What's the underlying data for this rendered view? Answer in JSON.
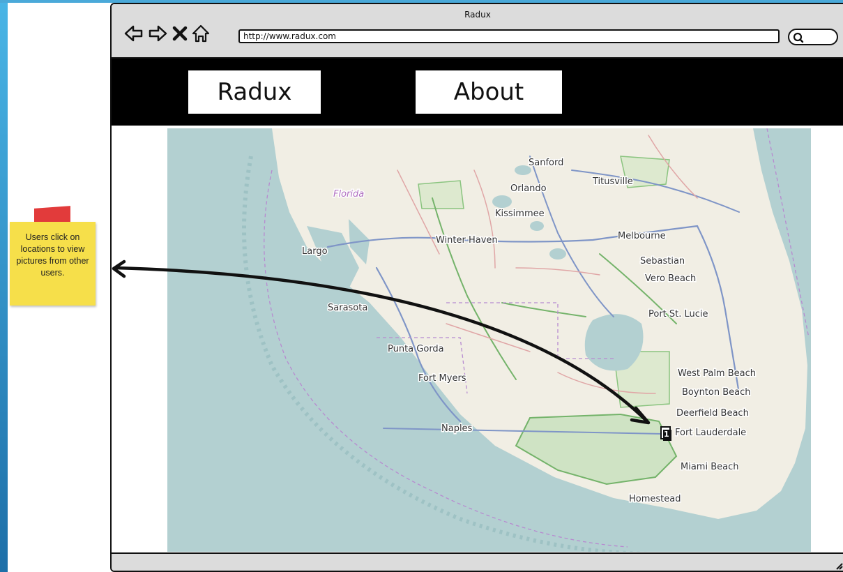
{
  "window": {
    "title": "Radux",
    "url": "http://www.radux.com"
  },
  "navbar": {
    "home_label": "Radux",
    "about_label": "About"
  },
  "note": {
    "text": "Users click on locations to view pictures from other users."
  },
  "map": {
    "labels": [
      {
        "id": "florida",
        "text": "Florida"
      },
      {
        "id": "sanford",
        "text": "Sanford"
      },
      {
        "id": "orlando",
        "text": "Orlando"
      },
      {
        "id": "titusville",
        "text": "Titusville"
      },
      {
        "id": "kissimmee",
        "text": "Kissimmee"
      },
      {
        "id": "melbourne",
        "text": "Melbourne"
      },
      {
        "id": "largo",
        "text": "Largo"
      },
      {
        "id": "winter-haven",
        "text": "Winter Haven"
      },
      {
        "id": "sebastian",
        "text": "Sebastian"
      },
      {
        "id": "vero-beach",
        "text": "Vero Beach"
      },
      {
        "id": "sarasota",
        "text": "Sarasota"
      },
      {
        "id": "port-st-lucie",
        "text": "Port St. Lucie"
      },
      {
        "id": "punta-gorda",
        "text": "Punta Gorda"
      },
      {
        "id": "west-palm-beach",
        "text": "West Palm Beach"
      },
      {
        "id": "fort-myers",
        "text": "Fort Myers"
      },
      {
        "id": "boynton-beach",
        "text": "Boynton Beach"
      },
      {
        "id": "deerfield-beach",
        "text": "Deerfield Beach"
      },
      {
        "id": "naples",
        "text": "Naples"
      },
      {
        "id": "fort-lauderdale",
        "text": "Fort Lauderdale"
      },
      {
        "id": "miami-beach",
        "text": "Miami Beach"
      },
      {
        "id": "homestead",
        "text": "Homestead"
      }
    ],
    "marker_label": "1"
  },
  "colors": {
    "water": "#b3d0d1",
    "land": "#f1eee4",
    "park": "#cfe3c4",
    "road_blue": "#7f95c7",
    "road_green": "#74b36a",
    "road_red": "#e0a6a6",
    "boundary": "#b78ad0",
    "note_yellow": "#f6df4a",
    "note_tab": "#e23b3b",
    "accent_blue": "#4aa9d9"
  }
}
